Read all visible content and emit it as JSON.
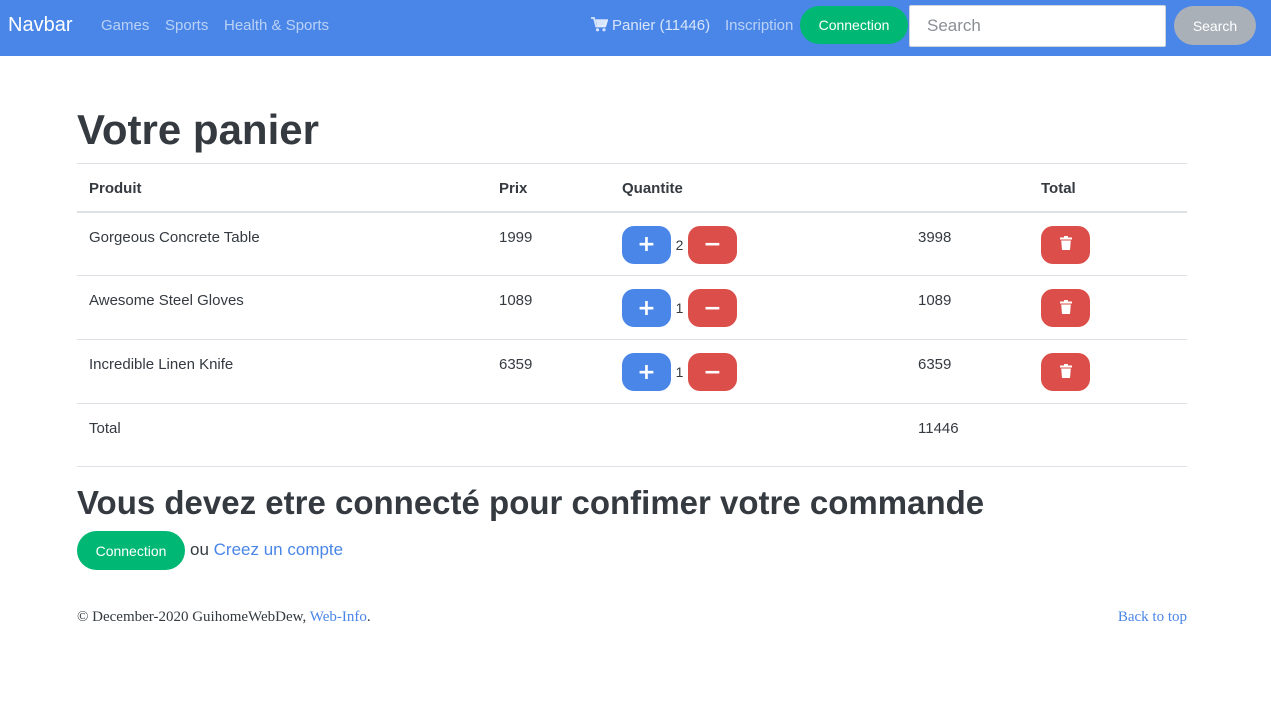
{
  "navbar": {
    "brand": "Navbar",
    "links": [
      "Games",
      "Sports",
      "Health & Sports"
    ],
    "cart_label": "Panier (11446)",
    "inscription": "Inscription",
    "connection": "Connection",
    "search_placeholder": "Search",
    "search_button": "Search"
  },
  "page_title": "Votre panier",
  "table": {
    "headers": [
      "Produit",
      "Prix",
      "Quantite",
      "",
      "Total"
    ],
    "rows": [
      {
        "product": "Gorgeous Concrete Table",
        "price": "1999",
        "quantity": "2",
        "total": "3998"
      },
      {
        "product": "Awesome Steel Gloves",
        "price": "1089",
        "quantity": "1",
        "total": "1089"
      },
      {
        "product": "Incredible Linen Knife",
        "price": "6359",
        "quantity": "1",
        "total": "6359"
      }
    ],
    "total_label": "Total",
    "grand_total": "11446"
  },
  "login_section": {
    "heading": "Vous devez etre connecté pour confimer votre commande",
    "connection_button": "Connection",
    "or_text": "ou",
    "create_account": "Creez un compte"
  },
  "footer": {
    "copyright": "© December-2020 GuihomeWebDew, ",
    "link": "Web-Info",
    "period": ".",
    "back_to_top": "Back to top"
  },
  "colors": {
    "primary": "#4a86e8",
    "success": "#00b874",
    "danger": "#db4e4a",
    "secondary": "#a9b0b8"
  },
  "icons": {
    "cart": "shopping-cart-icon",
    "plus": "plus-icon",
    "minus": "minus-icon",
    "delete": "trash-icon"
  }
}
